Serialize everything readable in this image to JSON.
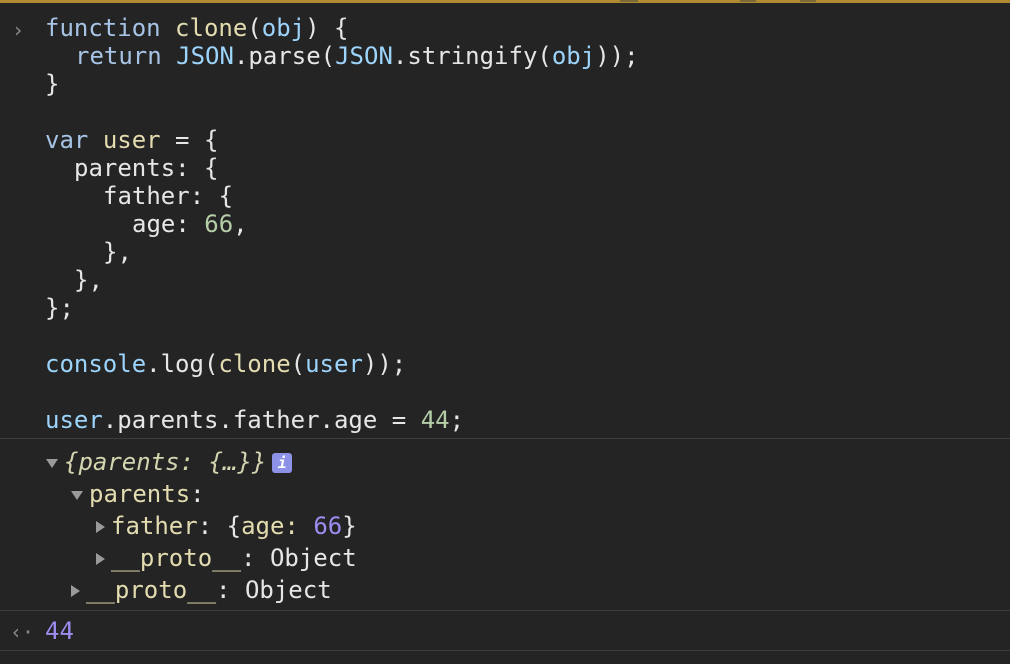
{
  "colors": {
    "background": "#242424",
    "keyword": "#a7c4e6",
    "function_name": "#e3dcb0",
    "variable": "#9cd4fb",
    "number": "#b5cea8",
    "object_number": "#9d8cf0",
    "top_border": "#b08a2e"
  },
  "icons": {
    "prompt": "chevron-right-icon",
    "return": "return-arrow-icon",
    "info": "info-badge-icon",
    "expanded": "triangle-down-icon",
    "collapsed": "triangle-right-icon"
  },
  "input": {
    "prompt_glyph": "›",
    "tokens": {
      "function_kw": "function",
      "clone_fn": "clone",
      "open_paren": "(",
      "obj_param": "obj",
      "close_paren_brace": ") {",
      "return_kw": "return",
      "json1": "JSON",
      "parse_call": ".parse(",
      "json2": "JSON",
      "stringify_call": ".stringify(",
      "obj_arg": "obj",
      "close_calls": "));",
      "close_brace": "}",
      "var_kw": "var",
      "user_decl": "user",
      "assign_open": " = {",
      "parents_line": "parents: {",
      "father_line": "father: {",
      "age_key": "age: ",
      "age_val": "66",
      "age_comma": ",",
      "close_father": "},",
      "close_parents": "},",
      "close_user": "};",
      "console_obj": "console",
      "log_call": ".log(",
      "clone_call": "clone",
      "paren_open": "(",
      "user_arg": "user",
      "close_log": "));",
      "user_ref": "user",
      "chain": ".parents.father.age",
      "assign": " = ",
      "new_age": "44",
      "semicolon": ";"
    }
  },
  "output": {
    "summary_open": "{parents: {…}}",
    "info_badge": "i",
    "parents_label": "parents",
    "parents_colon": ":",
    "father_key": "father",
    "father_open": ": {",
    "age_key": "age: ",
    "age_val": "66",
    "father_close": "}",
    "proto_label": "__proto__",
    "proto_sep": ": ",
    "proto_type": "Object",
    "proto2_label": "__proto__",
    "proto2_sep": ": ",
    "proto2_type": "Object"
  },
  "result": {
    "return_glyph": "‹·",
    "value": "44"
  }
}
